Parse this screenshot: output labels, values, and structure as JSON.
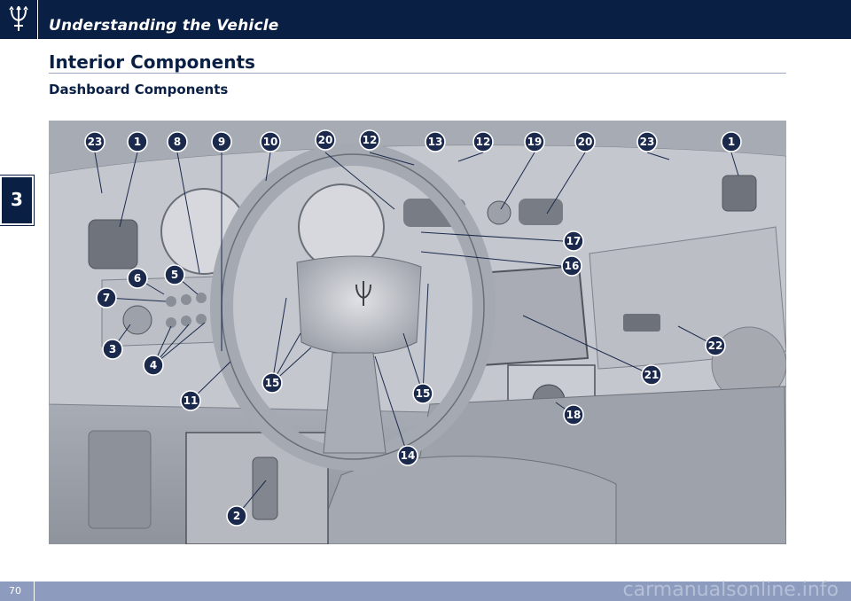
{
  "header": {
    "chapter_title": "Understanding the Vehicle"
  },
  "chapter_tab": {
    "number": "3"
  },
  "section": {
    "title": "Interior Components",
    "subtitle": "Dashboard Components"
  },
  "illustration": {
    "callouts": [
      "23",
      "1",
      "8",
      "9",
      "10",
      "20",
      "12",
      "13",
      "12",
      "19",
      "20",
      "23",
      "1",
      "17",
      "16",
      "6",
      "5",
      "7",
      "3",
      "4",
      "15",
      "15",
      "11",
      "14",
      "18",
      "21",
      "22",
      "2"
    ]
  },
  "footer": {
    "page_number": "70",
    "watermark": "carmanualsonline.info"
  },
  "colors": {
    "navy": "#0a1f44",
    "footer_blue": "#8d9bbf"
  },
  "icons": {
    "logo": "trident-logo-icon"
  }
}
